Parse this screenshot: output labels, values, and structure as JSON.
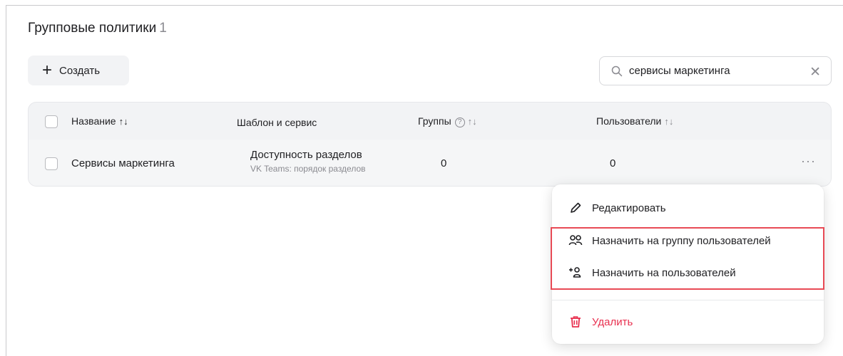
{
  "page": {
    "title": "Групповые политики",
    "count": "1"
  },
  "toolbar": {
    "create_label": "Создать",
    "search_value": "сервисы маркетинга"
  },
  "table": {
    "columns": {
      "name": "Название",
      "template": "Шаблон и сервис",
      "groups": "Группы",
      "users": "Пользователи"
    },
    "rows": [
      {
        "name": "Сервисы маркетинга",
        "template": "Доступность разделов",
        "service": "VK Teams: порядок разделов",
        "groups": "0",
        "users": "0"
      }
    ]
  },
  "context_menu": {
    "edit": "Редактировать",
    "assign_group": "Назначить на группу пользователей",
    "assign_users": "Назначить на пользователей",
    "delete": "Удалить"
  },
  "colors": {
    "accent_danger": "#e8304f",
    "highlight": "#e84a55"
  }
}
